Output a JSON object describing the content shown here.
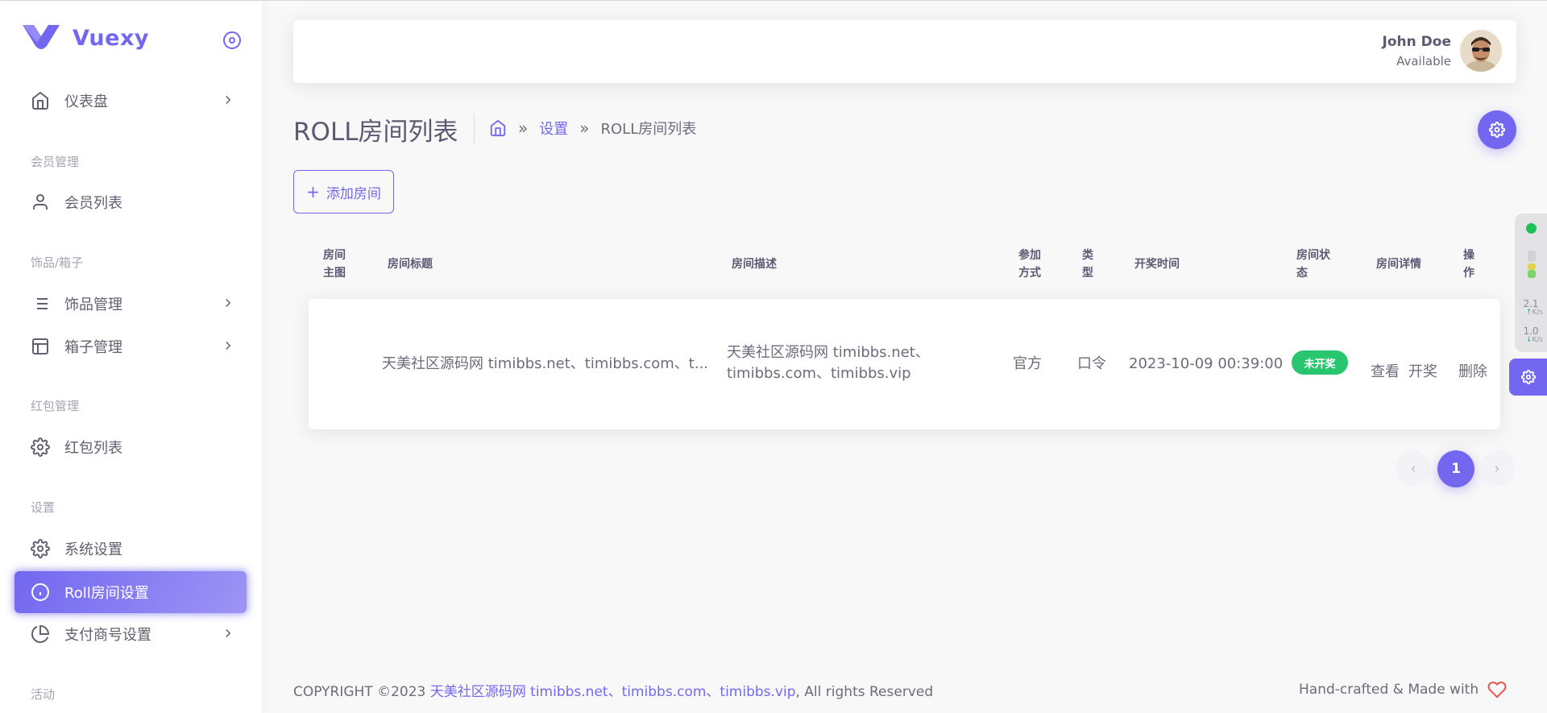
{
  "brand": {
    "name": "Vuexy",
    "color": "#7367f0"
  },
  "sidebar": {
    "items": [
      {
        "label": "仪表盘",
        "icon": "home-icon",
        "has_children": true
      },
      {
        "label": "会员列表",
        "icon": "user-icon",
        "has_children": false
      },
      {
        "label": "饰品管理",
        "icon": "list-icon",
        "has_children": true
      },
      {
        "label": "箱子管理",
        "icon": "layout-icon",
        "has_children": true
      },
      {
        "label": "红包列表",
        "icon": "gear-icon",
        "has_children": false
      },
      {
        "label": "系统设置",
        "icon": "gear-icon",
        "has_children": false
      },
      {
        "label": "Roll房间设置",
        "icon": "info-icon",
        "has_children": false,
        "active": true
      },
      {
        "label": "支付商号设置",
        "icon": "pie-chart-icon",
        "has_children": true
      }
    ],
    "headers": [
      "会员管理",
      "饰品/箱子",
      "红包管理",
      "设置",
      "活动"
    ]
  },
  "navbar": {
    "user_name": "John Doe",
    "user_status": "Available"
  },
  "page": {
    "title": "ROLL房间列表",
    "breadcrumb": {
      "settings": "设置",
      "current": "ROLL房间列表",
      "separator": "»"
    },
    "add_button": "添加房间"
  },
  "table": {
    "headers": {
      "image": [
        "房间",
        "主图"
      ],
      "title": "房间标题",
      "desc": "房间描述",
      "join": [
        "参加",
        "方式"
      ],
      "type": [
        "类",
        "型"
      ],
      "draw_time": "开奖时间",
      "status": [
        "房间状",
        "态"
      ],
      "detail": "房间详情",
      "ops": [
        "操",
        "作"
      ]
    },
    "rows": [
      {
        "title": "天美社区源码网 timibbs.net、timibbs.com、t...",
        "desc_line1": "天美社区源码网 timibbs.net、",
        "desc_line2": "timibbs.com、timibbs.vip",
        "join": "官方",
        "type": "口令",
        "draw_time": "2023-10-09 00:39:00",
        "status": "未开奖",
        "status_color": "#28c76f",
        "view": "查看",
        "draw": "开奖",
        "delete": "删除"
      }
    ]
  },
  "pagination": {
    "prev": "‹",
    "current": "1",
    "next": "›"
  },
  "footer": {
    "copyright_prefix": "COPYRIGHT ©2023 ",
    "copyright_link": "天美社区源码网 timibbs.net、timibbs.com、timibbs.vip",
    "copyright_suffix": ", All rights Reserved",
    "made_with": "Hand-crafted & Made with"
  },
  "net_widget": {
    "up_speed": "2.1",
    "down_speed": "1.0",
    "unit": "K/s"
  }
}
